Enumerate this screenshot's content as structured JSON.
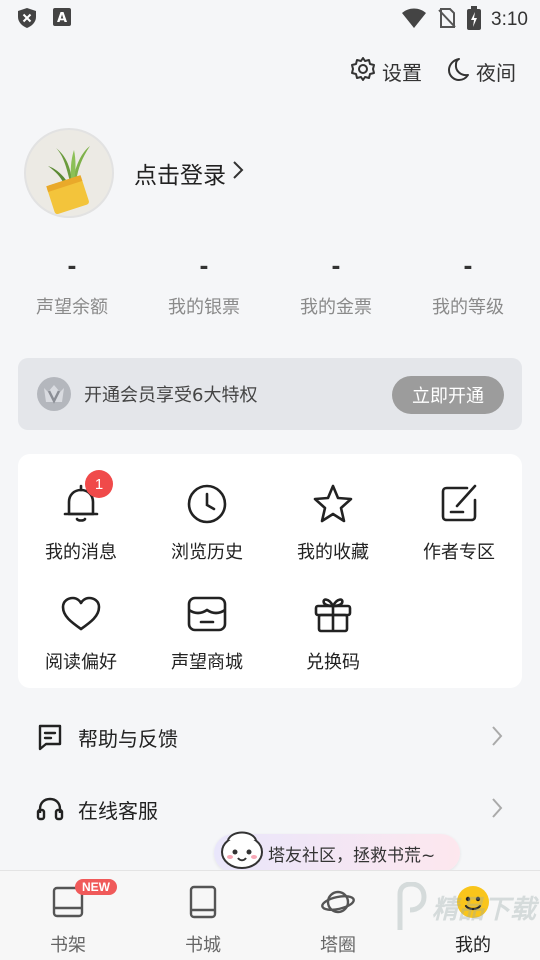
{
  "status_bar": {
    "time": "3:10"
  },
  "header": {
    "settings_label": "设置",
    "night_label": "夜间"
  },
  "profile": {
    "login_label": "点击登录"
  },
  "stats": [
    {
      "value": "-",
      "label": "声望余额"
    },
    {
      "value": "-",
      "label": "我的银票"
    },
    {
      "value": "-",
      "label": "我的金票"
    },
    {
      "value": "-",
      "label": "我的等级"
    }
  ],
  "vip": {
    "text": "开通会员享受6大特权",
    "button_label": "立即开通"
  },
  "grid": {
    "items": [
      {
        "label": "我的消息",
        "icon": "bell-icon",
        "badge": "1"
      },
      {
        "label": "浏览历史",
        "icon": "clock-icon"
      },
      {
        "label": "我的收藏",
        "icon": "star-icon"
      },
      {
        "label": "作者专区",
        "icon": "edit-icon"
      },
      {
        "label": "阅读偏好",
        "icon": "heart-icon"
      },
      {
        "label": "声望商城",
        "icon": "shop-icon"
      },
      {
        "label": "兑换码",
        "icon": "gift-icon"
      }
    ]
  },
  "list": [
    {
      "label": "帮助与反馈",
      "icon": "feedback-icon"
    },
    {
      "label": "在线客服",
      "icon": "headset-icon"
    }
  ],
  "community_tip": {
    "text": "塔友社区，拯救书荒~"
  },
  "bottom_nav": {
    "items": [
      {
        "label": "书架",
        "icon": "bookshelf-icon",
        "badge": "NEW"
      },
      {
        "label": "书城",
        "icon": "book-icon"
      },
      {
        "label": "塔圈",
        "icon": "planet-icon"
      },
      {
        "label": "我的",
        "icon": "smiley-icon",
        "active": true
      }
    ]
  },
  "watermark": {
    "text": "精品下载"
  },
  "colors": {
    "badge_red": "#f04a4a",
    "smiley_yellow": "#f9c51b",
    "vip_button": "#9c9c9c"
  }
}
